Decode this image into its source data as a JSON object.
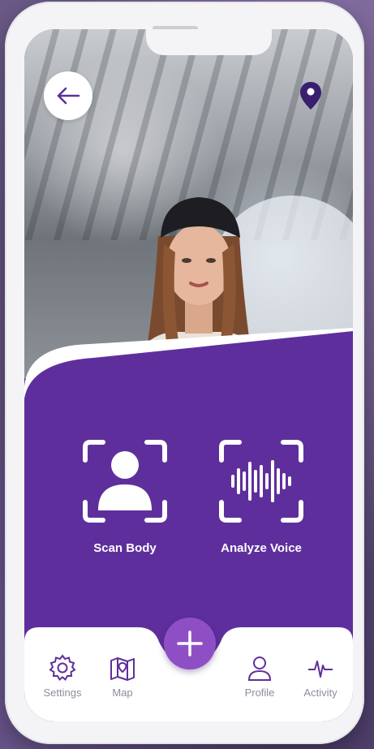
{
  "top_bar": {
    "back_icon": "arrow-left-icon",
    "location_icon": "map-pin-icon"
  },
  "actions": [
    {
      "label": "Scan Body",
      "icon": "scan-body-icon"
    },
    {
      "label": "Analyze Voice",
      "icon": "voice-waveform-icon"
    }
  ],
  "fab": {
    "icon": "plus-icon"
  },
  "nav": {
    "settings": {
      "label": "Settings",
      "icon": "gear-icon"
    },
    "map": {
      "label": "Map",
      "icon": "map-icon"
    },
    "profile": {
      "label": "Profile",
      "icon": "user-icon"
    },
    "activity": {
      "label": "Activity",
      "icon": "pulse-icon"
    }
  },
  "colors": {
    "primary": "#5e2f9c",
    "fab": "#8e4fc4",
    "nav_text": "#8f8c9b",
    "pin": "#3a1f6e"
  }
}
